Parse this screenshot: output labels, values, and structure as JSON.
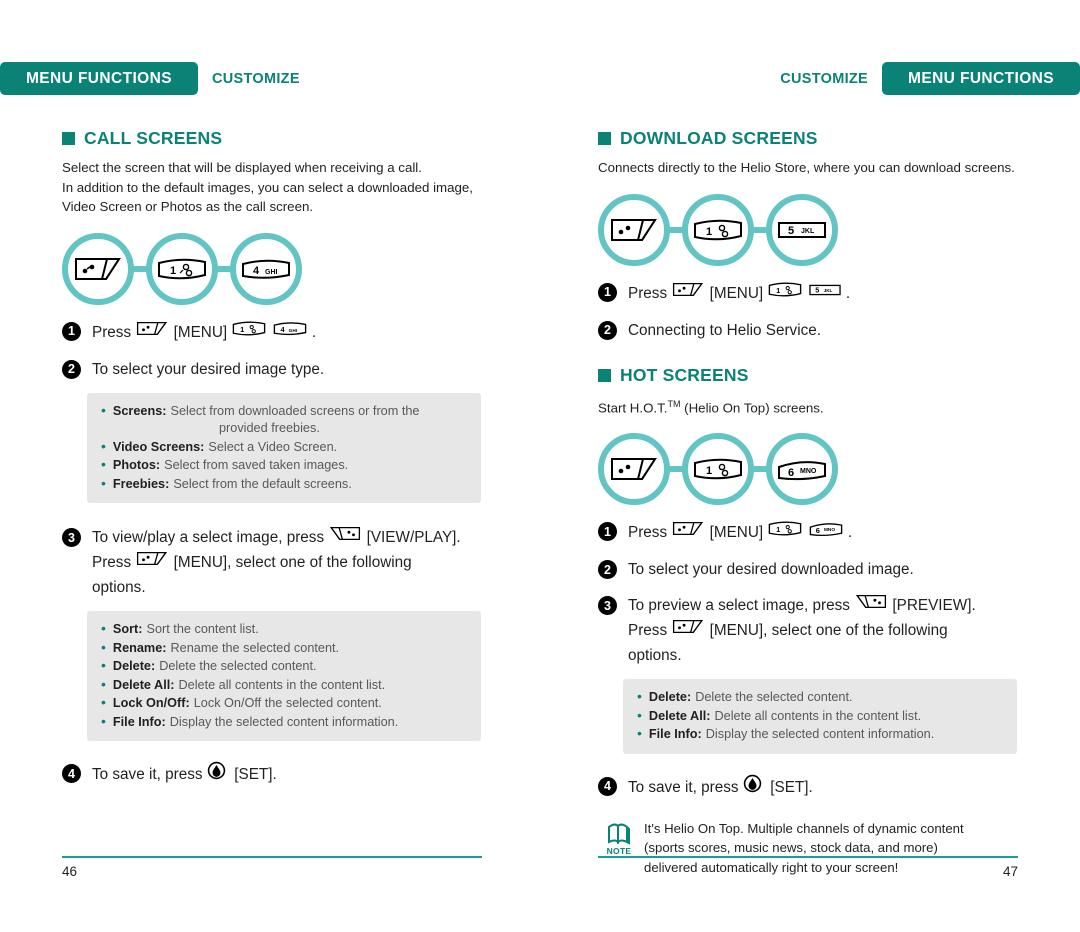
{
  "header": {
    "left": {
      "pill": "MENU FUNCTIONS",
      "sub": "CUSTOMIZE"
    },
    "right": {
      "pill": "MENU FUNCTIONS",
      "sub": "CUSTOMIZE"
    }
  },
  "colors": {
    "brand_teal": "#0a8276",
    "ring_teal": "#62c4c3",
    "rule_teal": "#1a9c9c",
    "box_gray": "#e7e7e7",
    "body_text": "#231f20",
    "muted_text": "#58595b"
  },
  "left": {
    "section": {
      "title": "CALL SCREENS",
      "desc_lines": [
        "Select the screen that will be displayed when receiving a call.",
        "In addition to the default images, you can select a downloaded image,",
        "Video Screen or Photos as the call screen."
      ]
    },
    "keys": [
      {
        "name": "menu-key",
        "type": "menu"
      },
      {
        "name": "key-1",
        "type": "num",
        "digit": "1",
        "sub": ""
      },
      {
        "name": "key-4",
        "type": "num",
        "digit": "4",
        "sub": "GHI"
      }
    ],
    "steps": [
      {
        "num": "1",
        "parts": [
          {
            "kind": "text",
            "value": "Press "
          },
          {
            "kind": "key",
            "icon": "menu-key"
          },
          {
            "kind": "text",
            "value": " [MENU] "
          },
          {
            "kind": "key",
            "icon": "key-1",
            "digit": "1",
            "sub": ""
          },
          {
            "kind": "text",
            "value": " "
          },
          {
            "kind": "key",
            "icon": "key-4",
            "digit": "4",
            "sub": "GHI"
          },
          {
            "kind": "text",
            "value": " ."
          }
        ]
      },
      {
        "num": "2",
        "parts": [
          {
            "kind": "text",
            "value": "To select your desired image type."
          }
        ]
      }
    ],
    "options_box_1": [
      {
        "label": "Screens:",
        "desc": "Select from downloaded screens or from the",
        "cont": "provided freebies."
      },
      {
        "label": "Video Screens:",
        "desc": "Select a Video Screen."
      },
      {
        "label": "Photos:",
        "desc": "Select from saved taken images."
      },
      {
        "label": "Freebies:",
        "desc": "Select from the default screens."
      }
    ],
    "step3": {
      "num": "3",
      "line1_a": "To view/play a select image, press ",
      "line1_key": "viewplay-key",
      "line1_b": " [VIEW/PLAY].",
      "line2_a": "Press ",
      "line2_key": "menu-key",
      "line2_b": " [MENU], select one of the following",
      "line3": "options."
    },
    "options_box_2": [
      {
        "label": "Sort:",
        "desc": "Sort the content list."
      },
      {
        "label": "Rename:",
        "desc": "Rename the selected content."
      },
      {
        "label": "Delete:",
        "desc": "Delete the selected content."
      },
      {
        "label": "Delete All:",
        "desc": "Delete all contents in the content list."
      },
      {
        "label": "Lock On/Off:",
        "desc": "Lock On/Off the selected content."
      },
      {
        "label": "File Info:",
        "desc": "Display the selected content information."
      }
    ],
    "step4": {
      "num": "4",
      "text_a": "To save it, press ",
      "key": "set-key",
      "text_b": "  [SET]."
    },
    "page_number": "46"
  },
  "right": {
    "section1": {
      "title": "DOWNLOAD SCREENS",
      "desc_lines": [
        "Connects directly to the Helio Store, where you can download screens."
      ],
      "keys": [
        {
          "name": "menu-key",
          "type": "menu"
        },
        {
          "name": "key-1",
          "type": "num",
          "digit": "1",
          "sub": ""
        },
        {
          "name": "key-5",
          "type": "num",
          "digit": "5",
          "sub": "JKL"
        }
      ],
      "steps": [
        {
          "num": "1",
          "parts": [
            {
              "kind": "text",
              "value": "Press "
            },
            {
              "kind": "key",
              "icon": "menu-key"
            },
            {
              "kind": "text",
              "value": " [MENU] "
            },
            {
              "kind": "key",
              "icon": "key-1",
              "digit": "1",
              "sub": ""
            },
            {
              "kind": "text",
              "value": " "
            },
            {
              "kind": "key",
              "icon": "key-5",
              "digit": "5",
              "sub": "JKL"
            },
            {
              "kind": "text",
              "value": " ."
            }
          ]
        },
        {
          "num": "2",
          "parts": [
            {
              "kind": "text",
              "value": "Connecting to Helio Service."
            }
          ]
        }
      ]
    },
    "section2": {
      "title": "HOT SCREENS",
      "desc_prefix": "Start H.O.T.",
      "desc_tm": "TM",
      "desc_suffix": " (Helio On Top) screens.",
      "keys": [
        {
          "name": "menu-key",
          "type": "menu"
        },
        {
          "name": "key-1",
          "type": "num",
          "digit": "1",
          "sub": ""
        },
        {
          "name": "key-6",
          "type": "num",
          "digit": "6",
          "sub": "MNO"
        }
      ],
      "steps": [
        {
          "num": "1",
          "parts": [
            {
              "kind": "text",
              "value": "Press "
            },
            {
              "kind": "key",
              "icon": "menu-key"
            },
            {
              "kind": "text",
              "value": " [MENU] "
            },
            {
              "kind": "key",
              "icon": "key-1",
              "digit": "1",
              "sub": ""
            },
            {
              "kind": "text",
              "value": " "
            },
            {
              "kind": "key",
              "icon": "key-6",
              "digit": "6",
              "sub": "MNO"
            },
            {
              "kind": "text",
              "value": " ."
            }
          ]
        },
        {
          "num": "2",
          "parts": [
            {
              "kind": "text",
              "value": "To select your desired downloaded image."
            }
          ]
        }
      ],
      "step3": {
        "num": "3",
        "line1_a": "To preview a select image, press ",
        "line1_key": "preview-key",
        "line1_b": " [PREVIEW].",
        "line2_a": "Press ",
        "line2_key": "menu-key",
        "line2_b": " [MENU], select one of the following",
        "line3": "options."
      },
      "options_box": [
        {
          "label": "Delete:",
          "desc": "Delete the selected content."
        },
        {
          "label": "Delete All:",
          "desc": "Delete all contents in the content list."
        },
        {
          "label": "File Info:",
          "desc": "Display the selected content information."
        }
      ],
      "step4": {
        "num": "4",
        "text_a": "To save it, press ",
        "key": "set-key",
        "text_b": "  [SET]."
      },
      "note": {
        "icon_label": "NOTE",
        "lines": [
          "It's Helio On Top. Multiple channels of dynamic content",
          "(sports scores, music news, stock data, and more)",
          "delivered automatically right to your screen!"
        ]
      }
    },
    "page_number": "47"
  }
}
